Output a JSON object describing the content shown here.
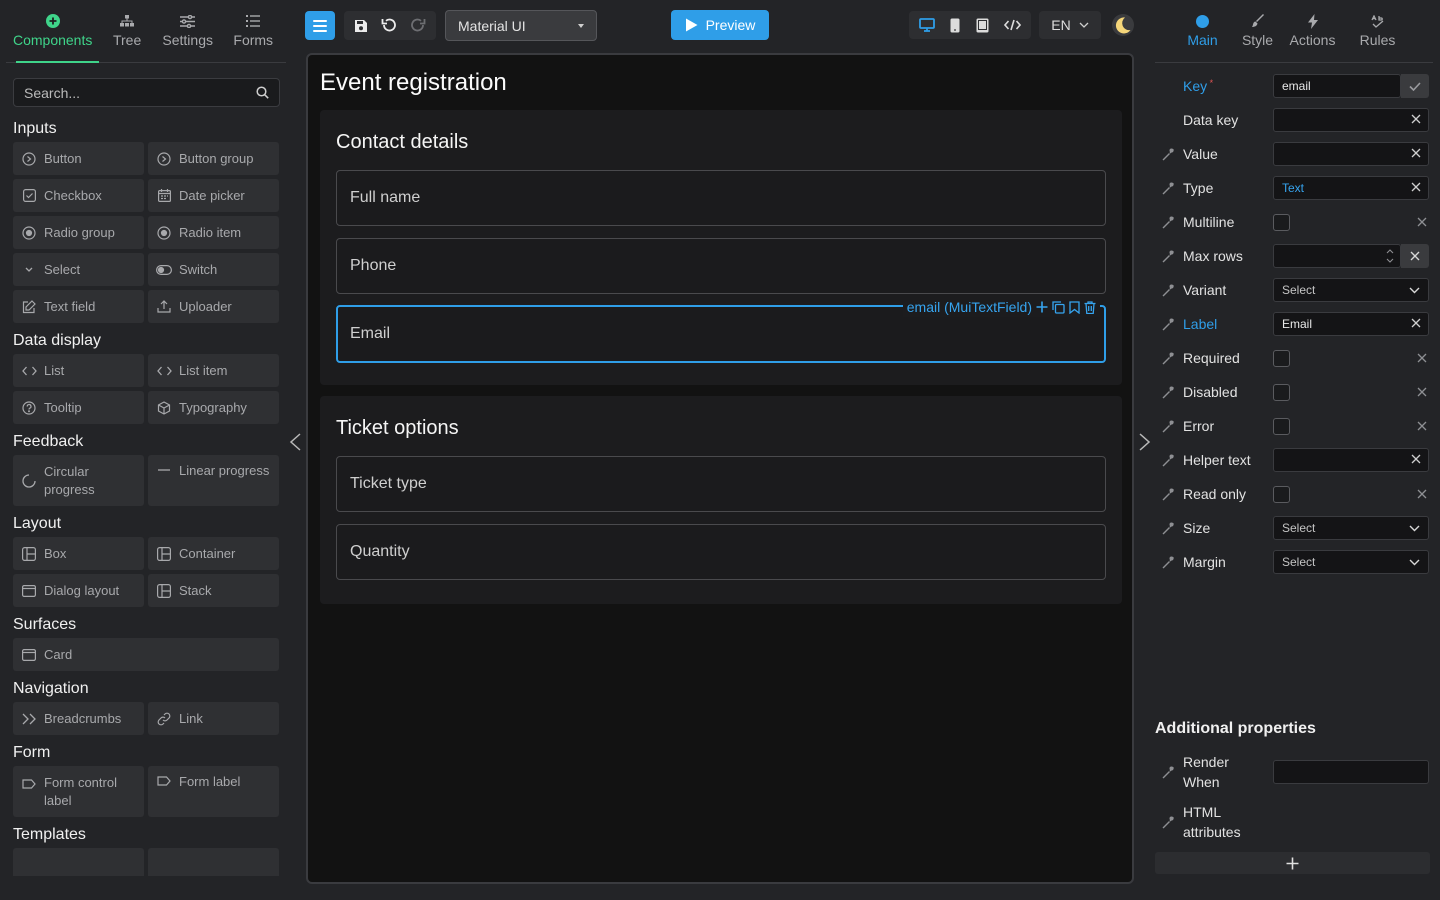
{
  "left_tabs": [
    {
      "label": "Components",
      "icon": "plus-circle-icon"
    },
    {
      "label": "Tree",
      "icon": "tree-icon"
    },
    {
      "label": "Settings",
      "icon": "sliders-icon"
    },
    {
      "label": "Forms",
      "icon": "list-icon"
    }
  ],
  "search": {
    "placeholder": "Search..."
  },
  "sections": {
    "inputs": {
      "title": "Inputs",
      "items": [
        "Button",
        "Button group",
        "Checkbox",
        "Date picker",
        "Radio group",
        "Radio item",
        "Select",
        "Switch",
        "Text field",
        "Uploader"
      ]
    },
    "data_display": {
      "title": "Data display",
      "items": [
        "List",
        "List item",
        "Tooltip",
        "Typography"
      ]
    },
    "feedback": {
      "title": "Feedback",
      "items": [
        "Circular progress",
        "Linear progress"
      ]
    },
    "layout": {
      "title": "Layout",
      "items": [
        "Box",
        "Container",
        "Dialog layout",
        "Stack"
      ]
    },
    "surfaces": {
      "title": "Surfaces",
      "items": [
        "Card"
      ]
    },
    "navigation": {
      "title": "Navigation",
      "items": [
        "Breadcrumbs",
        "Link"
      ]
    },
    "form": {
      "title": "Form",
      "items": [
        "Form control label",
        "Form label"
      ]
    },
    "templates": {
      "title": "Templates"
    }
  },
  "toolbar": {
    "ui_library": "Material UI",
    "preview_label": "Preview",
    "language": "EN"
  },
  "canvas": {
    "title": "Event registration",
    "cards": [
      {
        "title": "Contact details",
        "fields": [
          "Full name",
          "Phone",
          "Email"
        ]
      },
      {
        "title": "Ticket options",
        "fields": [
          "Ticket type",
          "Quantity"
        ]
      }
    ],
    "selected_tag": "email (MuiTextField)"
  },
  "right_tabs": [
    {
      "label": "Main",
      "icon": "dot-icon"
    },
    {
      "label": "Style",
      "icon": "brush-icon"
    },
    {
      "label": "Actions",
      "icon": "bolt-icon"
    },
    {
      "label": "Rules",
      "icon": "rules-icon"
    }
  ],
  "properties": {
    "key": {
      "label": "Key",
      "value": "email"
    },
    "data_key": {
      "label": "Data key",
      "value": ""
    },
    "value": {
      "label": "Value",
      "value": ""
    },
    "type": {
      "label": "Type",
      "value": "Text"
    },
    "multiline": {
      "label": "Multiline"
    },
    "max_rows": {
      "label": "Max rows",
      "value": ""
    },
    "variant": {
      "label": "Variant",
      "value": "Select"
    },
    "label": {
      "label": "Label",
      "value": "Email"
    },
    "required": {
      "label": "Required"
    },
    "disabled": {
      "label": "Disabled"
    },
    "error": {
      "label": "Error"
    },
    "helper_text": {
      "label": "Helper text",
      "value": ""
    },
    "read_only": {
      "label": "Read only"
    },
    "size": {
      "label": "Size",
      "value": "Select"
    },
    "margin": {
      "label": "Margin",
      "value": "Select"
    }
  },
  "additional": {
    "title": "Additional properties",
    "render_when": "Render When",
    "html_attributes": "HTML attributes"
  },
  "colors": {
    "accent_green": "#3fd48a",
    "accent_blue": "#2f9ee8",
    "background": "#232427",
    "canvas": "#121212"
  }
}
